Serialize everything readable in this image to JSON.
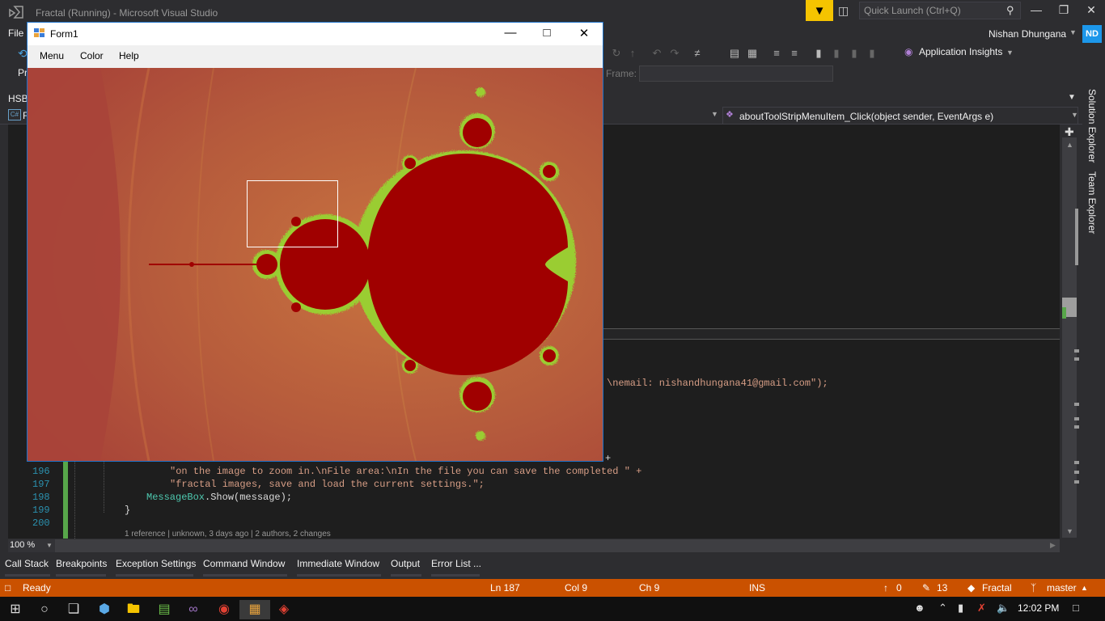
{
  "vs": {
    "title": "Fractal (Running) - Microsoft Visual Studio",
    "quick_launch_placeholder": "Quick Launch (Ctrl+Q)",
    "file_menu": "File",
    "user_name": "Nishan Dhungana",
    "user_initials": "ND",
    "toolbar_partial_text": "Pr",
    "app_insights": "Application Insights",
    "frame_label": "Frame:",
    "hsb_label": "HSB",
    "nav_partial": "F",
    "nav_method": "aboutToolStripMenuItem_Click(object sender, EventArgs e)",
    "side_tabs": [
      "Solution Explorer",
      "Team Explorer"
    ]
  },
  "code": {
    "email_fragment": "\\nemail: nishandhungana41@gmail.com\");",
    "partial_plus": "+",
    "lines": [
      {
        "num": "196",
        "text": "\"on the image to zoom in.\\nFile area:\\nIn the file you can save the completed \" +"
      },
      {
        "num": "197",
        "text": "\"fractal images, save and load the current settings.\";"
      },
      {
        "num": "198",
        "cls": "MessageBox",
        "text": ".Show(message);"
      },
      {
        "num": "199",
        "text": "}"
      },
      {
        "num": "200",
        "text": ""
      }
    ],
    "codelens": "1 reference | unknown, 3 days ago | 2 authors, 2 changes",
    "zoom": "100 %"
  },
  "tool_tabs": [
    "Call Stack",
    "Breakpoints",
    "Exception Settings",
    "Command Window",
    "Immediate Window",
    "Output",
    "Error List ..."
  ],
  "status": {
    "ready": "Ready",
    "ln": "Ln 187",
    "col": "Col 9",
    "ch": "Ch 9",
    "ins": "INS",
    "pushes": "0",
    "edits": "13",
    "repo": "Fractal",
    "branch": "master"
  },
  "taskbar": {
    "time": "12:02 PM"
  },
  "form1": {
    "title": "Form1",
    "menu": [
      "Menu",
      "Color",
      "Help"
    ]
  },
  "colors": {
    "status_orange": "#ca5100",
    "fractal_bg": "#b04a3a",
    "fractal_set": "#a00000",
    "fractal_edge": "#9acd32"
  }
}
